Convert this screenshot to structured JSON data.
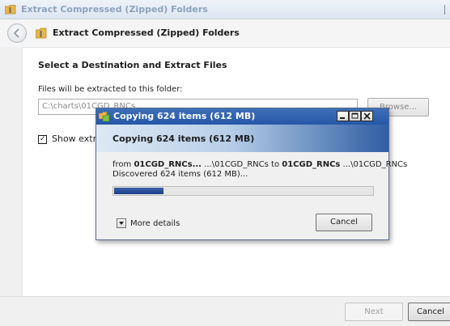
{
  "window": {
    "title": "Extract Compressed (Zipped) Folders"
  },
  "nav": {
    "title": "Extract Compressed (Zipped) Folders",
    "back_icon": "back-arrow-icon"
  },
  "panel": {
    "heading": "Select a Destination and Extract Files",
    "dest_label": "Files will be extracted to this folder:",
    "dest_value": "C:\\charts\\01CGD_RNCs",
    "browse_label": "Browse...",
    "show_label": "Show extracted files when complete",
    "show_checked": true
  },
  "footer": {
    "next_label": "Next",
    "cancel_label": "Cancel"
  },
  "copy_dialog": {
    "title": "Copying 624 items (612 MB)",
    "header": "Copying 624 items (612 MB)",
    "from_prefix": "from ",
    "from_source": "01CGD_RNCs...",
    "from_source_path": " ...\\01CGD_RNCs to ",
    "from_dest": "01CGD_RNCs",
    "from_dest_path": " ...\\01CGD_RNCs",
    "discovered": "Discovered 624 items (612 MB)...",
    "progress_fraction": 0.19,
    "more_details_label": "More details",
    "cancel_label": "Cancel"
  },
  "colors": {
    "title_bar_active": "#2557a7",
    "progress_fill": "#1a3f8a",
    "folder_yellow": "#e8b64a"
  }
}
